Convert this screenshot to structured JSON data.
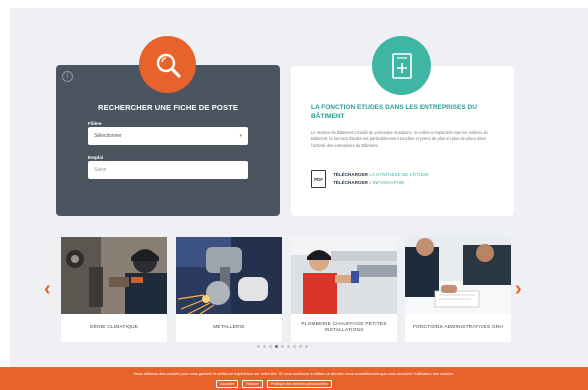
{
  "search_card": {
    "title": "RECHERCHER UNE FICHE DE POSTE",
    "filiere_label": "Filière",
    "filiere_value": "Sélectionner",
    "emploi_label": "Emploi",
    "emploi_placeholder": "Saisir",
    "info_glyph": "i"
  },
  "info_card": {
    "title": "LA FONCTION ETUDES DANS LES ENTREPRISES DU BÂTIMENT",
    "text": "Le secteur du Bâtiment connaît de profondes mutations. Si celles-ci impactent tous les métiers du Bâtiment, la fonction Études est particulièrement touchée et prend de plus en plus de place dans l'activité des entreprises du Bâtiment.",
    "pdf_label": "PDF",
    "download_1_prefix": "TÉLÉCHARGER",
    "download_1_link": "LA SYNTHÈSE DE L'ÉTUDE",
    "download_2_prefix": "TÉLÉCHARGER",
    "download_2_link": "L'INFOGRAPHIE"
  },
  "carousel": {
    "prev_glyph": "‹",
    "next_glyph": "›",
    "cards": [
      {
        "label": "GÉNIE CLIMATIQUE"
      },
      {
        "label": "MÉTALLERIE"
      },
      {
        "label": "PLOMBERIE CHAUFFAGE PETITES INSTALLATIONS"
      },
      {
        "label": "FONCTIONS ADMINISTRATIVES GRH"
      }
    ],
    "dot_count": 9,
    "active_dot": 3
  },
  "cookie_bar": {
    "text": "Nous utilisons des cookies pour vous garantir la meilleure expérience sur notre site. Si vous continuez à utiliser ce dernier, nous considérerons que vous acceptez l'utilisation des cookies.",
    "accept_label": "Accepter",
    "refuse_label": "Refuser",
    "policy_label": "Politique des données personnelles"
  },
  "colors": {
    "accent_orange": "#e8622c",
    "accent_teal": "#3fb5a3",
    "card_dark": "#4a5560"
  },
  "icons": {
    "search": "search-icon",
    "document": "document-plus-icon",
    "pdf": "pdf-icon"
  }
}
